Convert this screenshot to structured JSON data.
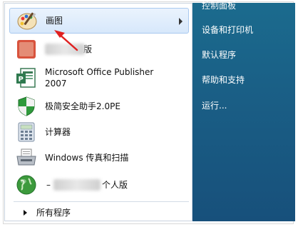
{
  "start_menu": {
    "programs": [
      {
        "label": "画图",
        "icon": "paint-icon",
        "selected": true,
        "has_submenu": true
      },
      {
        "label": "版",
        "icon": "app-icon-redacted",
        "label_partially_redacted": true
      },
      {
        "label_line1": "Microsoft Office Publisher",
        "label_line2": "2007",
        "icon": "publisher-icon"
      },
      {
        "label": "极简安全助手2.0PE",
        "icon": "shield-icon"
      },
      {
        "label": "计算器",
        "icon": "calculator-icon"
      },
      {
        "label": "Windows 传真和扫描",
        "icon": "fax-icon"
      },
      {
        "label": "个人版",
        "icon": "globe-icon",
        "label_partially_redacted": true
      }
    ],
    "all_programs_label": "所有程序",
    "right_items": [
      "控制面板",
      "设备和打印机",
      "默认程序",
      "帮助和支持",
      "运行..."
    ]
  },
  "annotation": {
    "type": "red-arrow",
    "target": "画图",
    "color": "#e02020"
  }
}
